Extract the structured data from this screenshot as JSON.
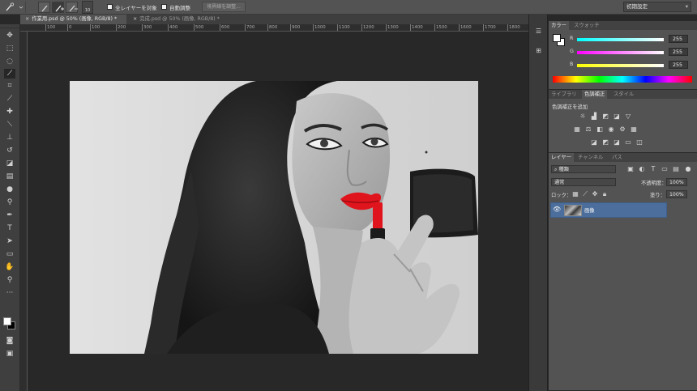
{
  "options_bar": {
    "brush_size": "10",
    "sample_all_layers_label": "全レイヤーを対象",
    "auto_enhance_label": "自動調整",
    "refine_edge_label": "境界線を調整...",
    "workspace_label": "初期設定"
  },
  "tabs": [
    {
      "label": "作業用.psd @ 50% (画像, RGB/8) *",
      "close": "×"
    },
    {
      "label": "完成.psd @ 50% (画像, RGB/8) *",
      "close": "×"
    }
  ],
  "ruler": {
    "ticks": [
      "100",
      "0",
      "100",
      "200",
      "300",
      "400",
      "500",
      "600",
      "700",
      "800",
      "900",
      "1000",
      "1100",
      "1200",
      "1300",
      "1400",
      "1500",
      "1600",
      "1700",
      "1800"
    ]
  },
  "color_panel": {
    "tabs": [
      "カラー",
      "スウォッチ"
    ],
    "channels": [
      {
        "label": "R",
        "value": "255",
        "color": "#ff0000"
      },
      {
        "label": "G",
        "value": "255",
        "color": "#00ff00"
      },
      {
        "label": "B",
        "value": "255",
        "color": "#0000ff"
      }
    ]
  },
  "adjustments_panel": {
    "tabs": [
      "ライブラリ",
      "色調補正",
      "スタイル"
    ],
    "title": "色調補正を追加"
  },
  "layers_panel": {
    "tabs": [
      "レイヤー",
      "チャンネル",
      "パス"
    ],
    "filter_label": "種類",
    "blend_mode": "通常",
    "opacity_label": "不透明度：",
    "opacity_value": "100%",
    "lock_label": "ロック：",
    "fill_label": "塗り：",
    "fill_value": "100%",
    "layers": [
      {
        "name": "画像",
        "visible": true,
        "selected": true
      }
    ]
  },
  "colors": {
    "ui_dark": "#282828",
    "panel": "#535353",
    "selection": "#4b6e9d",
    "lipstick": "#e0141c"
  }
}
